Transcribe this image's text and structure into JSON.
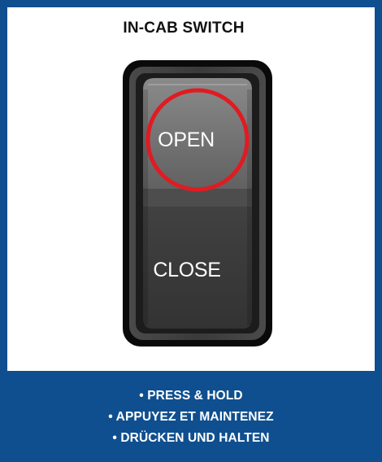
{
  "title": "IN-CAB SWITCH",
  "switch": {
    "open_label": "OPEN",
    "close_label": "CLOSE",
    "highlight_color": "#e01b22",
    "highlighted_position": "OPEN"
  },
  "instructions": [
    "• PRESS & HOLD",
    "• APPUYEZ ET MAINTENEZ",
    "• DRÜCKEN UND HALTEN"
  ],
  "colors": {
    "brand_blue": "#0f4f8f",
    "switch_body": "#2b2b2b"
  }
}
